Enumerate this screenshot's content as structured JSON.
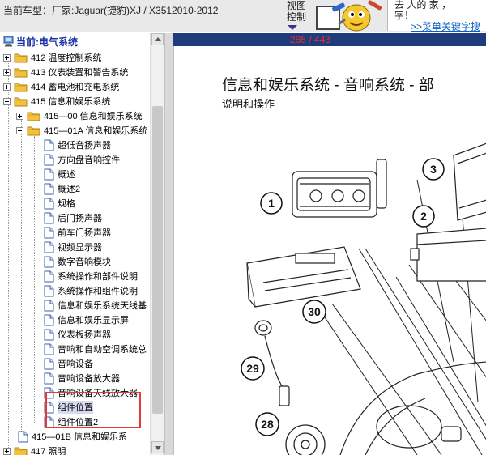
{
  "topbar": {
    "car_model": "当前车型：厂家:Jaguar(捷豹)XJ / X3512010-2012",
    "view_control_line1": "视图",
    "view_control_line2": "控制",
    "promo_line1": "去   人的 家 ，",
    "promo_line2": "字！",
    "promo_link": ">>菜单关键字搜"
  },
  "tree": {
    "current_system": "当前:电气系统",
    "nodes": [
      {
        "label": "412 温度控制系统",
        "level": 0,
        "type": "folder",
        "expanded": false
      },
      {
        "label": "413 仪表装置和警告系统",
        "level": 0,
        "type": "folder",
        "expanded": false
      },
      {
        "label": "414 蓄电池和充电系统",
        "level": 0,
        "type": "folder",
        "expanded": false
      },
      {
        "label": "415 信息和娱乐系统",
        "level": 0,
        "type": "folder",
        "expanded": true
      },
      {
        "label": "415—00 信息和娱乐系统",
        "level": 1,
        "type": "folder",
        "expanded": false
      },
      {
        "label": "415—01A 信息和娱乐系统",
        "level": 1,
        "type": "folder",
        "expanded": true
      },
      {
        "label": "超低音扬声器",
        "level": 2,
        "type": "doc"
      },
      {
        "label": "方向盘音响控件",
        "level": 2,
        "type": "doc"
      },
      {
        "label": "概述",
        "level": 2,
        "type": "doc"
      },
      {
        "label": "概述2",
        "level": 2,
        "type": "doc"
      },
      {
        "label": "规格",
        "level": 2,
        "type": "doc"
      },
      {
        "label": "后门扬声器",
        "level": 2,
        "type": "doc"
      },
      {
        "label": "前车门扬声器",
        "level": 2,
        "type": "doc"
      },
      {
        "label": "视频显示器",
        "level": 2,
        "type": "doc"
      },
      {
        "label": "数字音响模块",
        "level": 2,
        "type": "doc"
      },
      {
        "label": "系统操作和部件说明",
        "level": 2,
        "type": "doc"
      },
      {
        "label": "系统操作和组件说明",
        "level": 2,
        "type": "doc"
      },
      {
        "label": "信息和娱乐系统天线基",
        "level": 2,
        "type": "doc"
      },
      {
        "label": "信息和娱乐显示屏",
        "level": 2,
        "type": "doc"
      },
      {
        "label": "仪表板扬声器",
        "level": 2,
        "type": "doc"
      },
      {
        "label": "音响和自动空调系统总",
        "level": 2,
        "type": "doc"
      },
      {
        "label": "音响设备",
        "level": 2,
        "type": "doc"
      },
      {
        "label": "音响设备放大器",
        "level": 2,
        "type": "doc"
      },
      {
        "label": "音响设备天线放大器",
        "level": 2,
        "type": "doc"
      },
      {
        "label": "组件位置",
        "level": 2,
        "type": "doc",
        "selected": true
      },
      {
        "label": "组件位置2",
        "level": 2,
        "type": "doc"
      },
      {
        "label": "415—01B 信息和娱乐系",
        "level": 1,
        "type": "doc"
      },
      {
        "label": "417 照明",
        "level": 0,
        "type": "folder",
        "expanded": false
      }
    ]
  },
  "viewer": {
    "page_counter": "285 / 443",
    "doc_title": "信息和娱乐系统 - 音响系统  - 部",
    "doc_subtitle": "说明和操作",
    "callouts": [
      "1",
      "2",
      "3",
      "28",
      "29",
      "30"
    ]
  },
  "colors": {
    "viewer_bar": "#1e3c7c",
    "page_counter": "#e03030",
    "highlight_box": "#e23b3b",
    "tree_header": "#1b2fa6",
    "link": "#0b5fc2",
    "folder_yellow": "#f2c23c"
  },
  "icons": [
    "computer-icon",
    "folder-icon",
    "document-icon",
    "expand-plus-icon",
    "collapse-minus-icon",
    "mascot-icon"
  ]
}
